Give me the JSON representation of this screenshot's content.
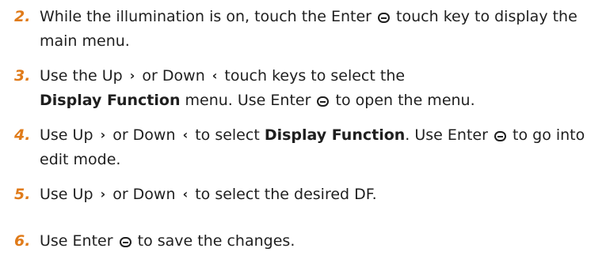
{
  "steps": [
    {
      "number": "2.",
      "t1": "While the illumination is on, touch the Enter",
      "t2": "touch key to display the main menu."
    },
    {
      "number": "3.",
      "t1": "Use the Up",
      "t2": "or Down",
      "t3": "touch keys to select the",
      "b1": "Display Function",
      "t4": "menu. Use Enter",
      "t5": "to open the menu."
    },
    {
      "number": "4.",
      "t1": "Use Up",
      "t2": "or Down",
      "t3": "to select",
      "b1": "Display Function",
      "t4": ". Use Enter",
      "t5": "to go into edit mode."
    },
    {
      "number": "5.",
      "t1": "Use Up",
      "t2": "or Down",
      "t3": "to select the desired DF."
    },
    {
      "number": "6.",
      "t1": "Use Enter",
      "t2": "to save the changes."
    }
  ],
  "icons": {
    "up": "›",
    "down": "‹"
  }
}
